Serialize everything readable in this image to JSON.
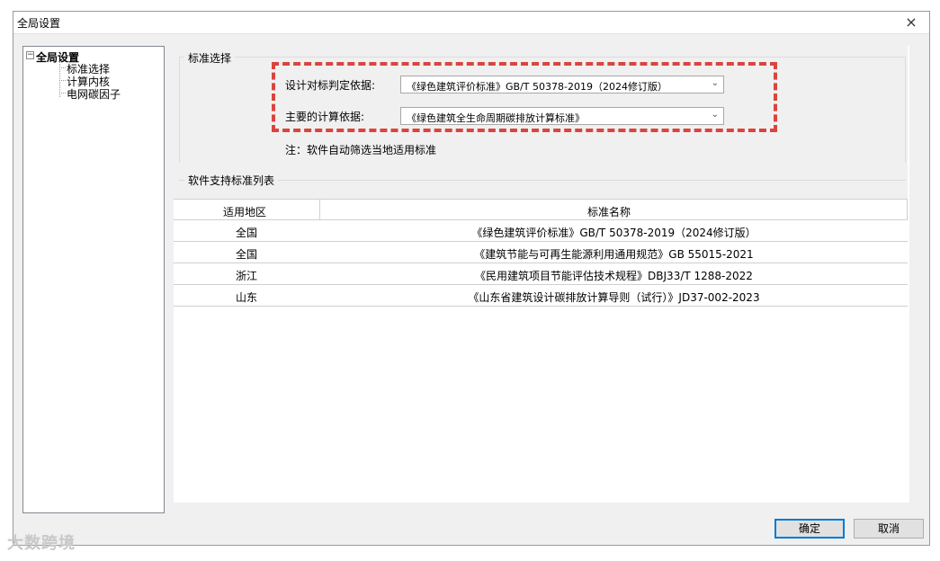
{
  "dialog": {
    "title": "全局设置",
    "close_glyph": "×"
  },
  "tree": {
    "expander": "−",
    "root": "全局设置",
    "items": [
      "标准选择",
      "计算内核",
      "电网碳因子"
    ]
  },
  "standard_selection": {
    "group_label": "标准选择",
    "benchmark_label": "设计对标判定依据:",
    "benchmark_value": "《绿色建筑评价标准》GB/T 50378-2019（2024修订版）",
    "calc_label": "主要的计算依据:",
    "calc_value": "《绿色建筑全生命周期碳排放计算标准》",
    "dropdown_glyph": "⌄",
    "note": "注：软件自动筛选当地适用标准"
  },
  "supported_list": {
    "title": "软件支持标准列表",
    "columns": [
      "适用地区",
      "标准名称"
    ],
    "rows": [
      {
        "region": "全国",
        "name": "《绿色建筑评价标准》GB/T 50378-2019（2024修订版）"
      },
      {
        "region": "全国",
        "name": "《建筑节能与可再生能源利用通用规范》GB 55015-2021"
      },
      {
        "region": "浙江",
        "name": "《民用建筑项目节能评估技术规程》DBJ33/T 1288-2022"
      },
      {
        "region": "山东",
        "name": "《山东省建筑设计碳排放计算导则（试行）》JD37-002-2023"
      }
    ]
  },
  "buttons": {
    "ok": "确定",
    "cancel": "取消"
  },
  "watermark": "大数跨境",
  "colors": {
    "highlight": "#d9453e",
    "accent": "#0078d7"
  }
}
